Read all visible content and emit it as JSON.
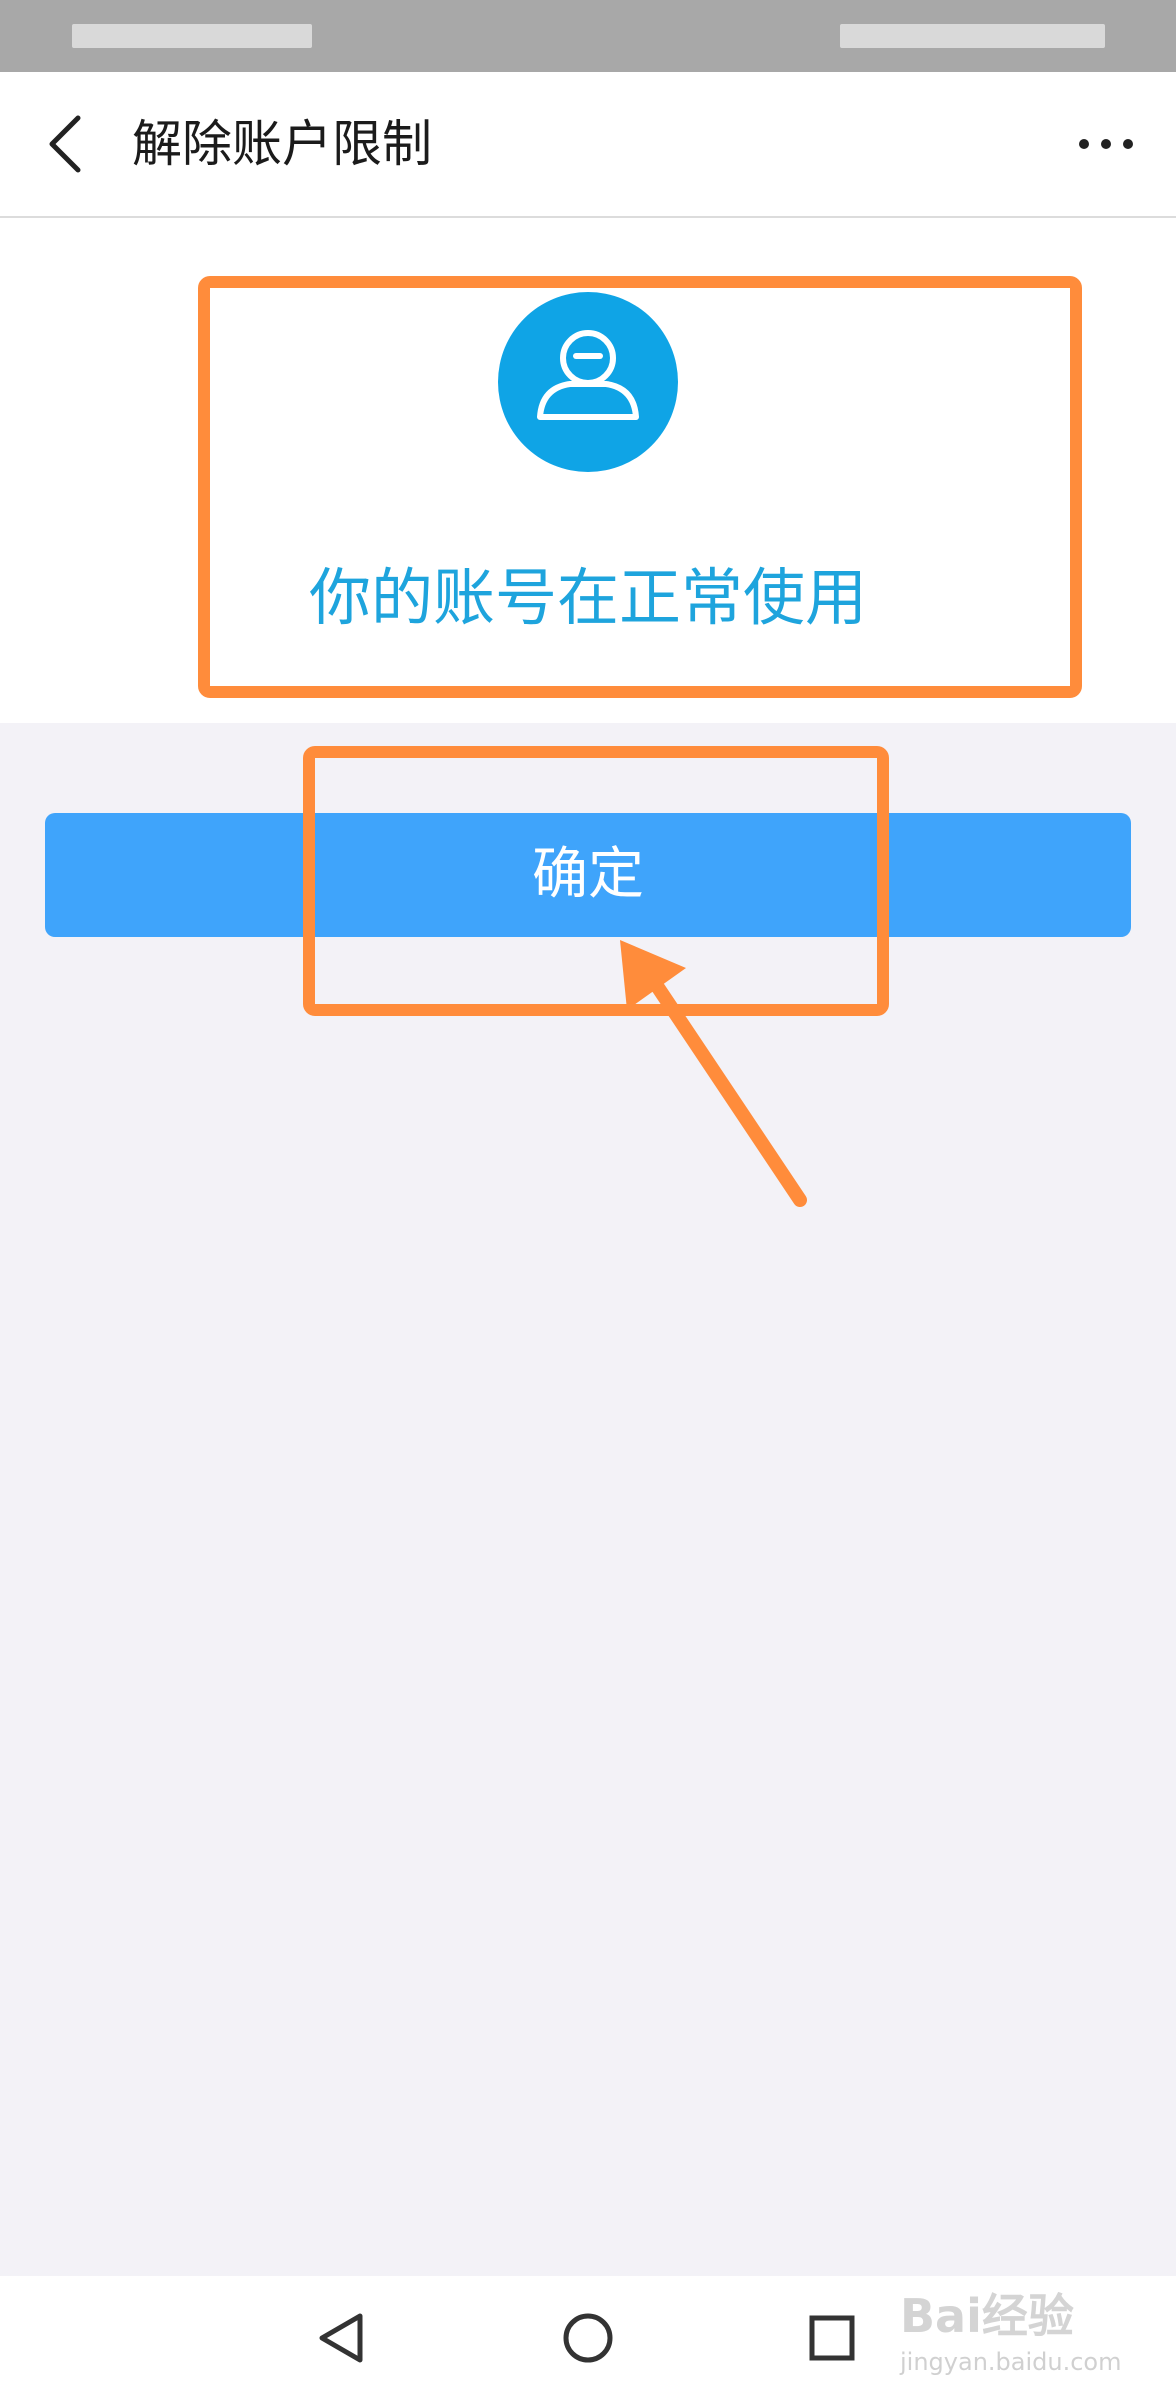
{
  "nav": {
    "title": "解除账户限制",
    "back_icon": "chevron-left-icon",
    "more_icon": "more-horizontal-icon"
  },
  "status": {
    "avatar_icon": "user-icon",
    "message": "你的账号在正常使用"
  },
  "confirm_button": {
    "label": "确定"
  },
  "system_nav": {
    "back_icon": "triangle-back-icon",
    "home_icon": "circle-home-icon",
    "recent_icon": "square-recent-icon"
  },
  "watermark": {
    "brand": "Bai经验",
    "site": "jingyan.baidu.com"
  },
  "colors": {
    "accent_blue": "#3fa4fb",
    "avatar_blue": "#0fa4e6",
    "message_blue": "#1ea4dd",
    "annotation_orange": "#ff8c3b",
    "page_background": "#f3f2f7"
  }
}
